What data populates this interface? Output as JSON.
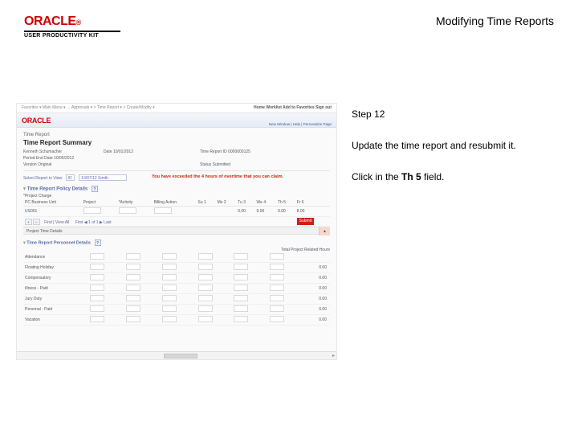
{
  "header": {
    "product_line": "USER PRODUCTIVITY KIT",
    "page_title": "Modifying Time Reports"
  },
  "instructions": {
    "step_label": "Step 12",
    "body": "Update the time report and resubmit it.",
    "action_prefix": "Click in the ",
    "action_target": "Th 5",
    "action_suffix": " field."
  },
  "shot": {
    "topbar": {
      "crumbs": "Favorites ▾   Main Menu ▾   … Approvals ▾   > Time Report ▾   > Create/Modify ▾",
      "links": "Home   Worklist   Add to Favorites   Sign out"
    },
    "midbar": {
      "brand": "ORACLE",
      "prefs": "New Window | Help | Personalize Page"
    },
    "heading_small": "Time Report",
    "heading": "Time Report Summary",
    "meta": {
      "name_k": "Kenneth Schumacher",
      "date_k": "Date 10/01/2012",
      "trid_k": "Time Report ID 0000000125",
      "period_k": "Period End Date 10/05/2012",
      "version_k": "Version Original",
      "status_k": "Status Submitted"
    },
    "sel_label": "Select Report to View:",
    "sel_iba": "ID",
    "sel_ibb": "10/07/12 Smith",
    "note": "You have exceeded the 4 hours of overtime that you can claim.",
    "sec_details": "Time Report Policy Details",
    "project_label": "*Project Charge",
    "det_cols": [
      "PC Business Unit",
      "Project",
      "*Activity",
      "Billing Action",
      "Su 1",
      "Mo 2",
      "Tu 3",
      "We 4",
      "Th 5",
      "Fr 6"
    ],
    "det_row": {
      "bu": "US001",
      "projsel": "▾",
      "find": "Find | View All",
      "first_last": "First ◀ 1 of 1 ▶ Last"
    },
    "det_vals": [
      "",
      "",
      "9.00",
      "9.00",
      "9.00",
      "8.00"
    ],
    "submit": "Submit",
    "band": "Project Time Details",
    "reported_h": "Time Report Personnel Details",
    "total_label": "Total Project Related Hours",
    "rep_rows": [
      {
        "l": "Attendance",
        "t": ""
      },
      {
        "l": "Floating Holiday",
        "t": "0.00"
      },
      {
        "l": "Compensatory",
        "t": "0.00"
      },
      {
        "l": "Illness - Paid",
        "t": "0.00"
      },
      {
        "l": "Jury Duty",
        "t": "0.00"
      },
      {
        "l": "Personal - Paid",
        "t": "0.00"
      },
      {
        "l": "Vacation",
        "t": "0.00"
      }
    ]
  }
}
